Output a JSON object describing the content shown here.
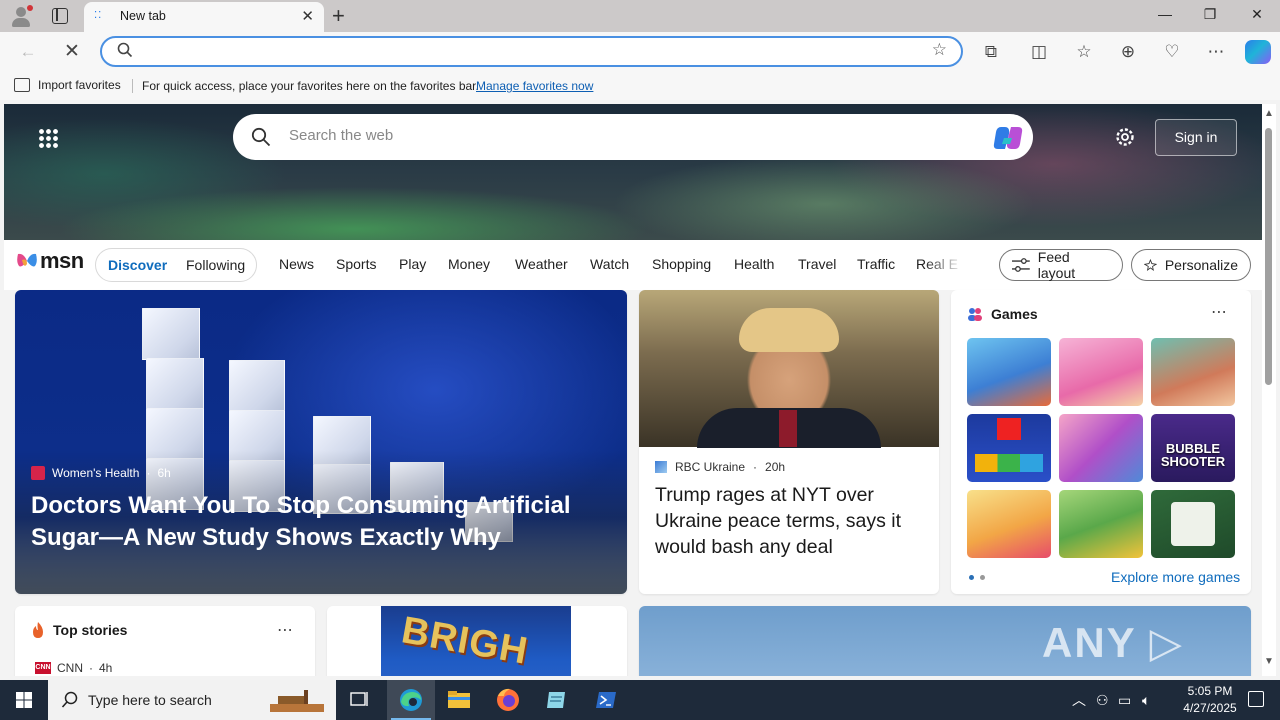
{
  "browser": {
    "tab_title": "New tab",
    "address_value": "",
    "favorites_bar": {
      "import_label": "Import favorites",
      "hint": "For quick access, place your favorites here on the favorites bar.",
      "manage_link": "Manage favorites now"
    }
  },
  "page": {
    "search_placeholder": "Search the web",
    "signin_label": "Sign in",
    "logo_text": "msn",
    "feed_tabs": [
      "Discover",
      "Following"
    ],
    "nav_links": [
      "News",
      "Sports",
      "Play",
      "Money",
      "Weather",
      "Watch",
      "Shopping",
      "Health",
      "Travel",
      "Traffic",
      "Real E"
    ],
    "feed_layout_label": "Feed layout",
    "personalize_label": "Personalize",
    "hero": {
      "source": "Women's Health",
      "age": "6h",
      "title": "Doctors Want You To Stop Consuming Artificial Sugar—A New Study Shows Exactly Why"
    },
    "story2": {
      "source": "RBC Ukraine",
      "age": "20h",
      "title": "Trump rages at NYT over Ukraine peace terms, says it would bash any deal"
    },
    "games": {
      "title": "Games",
      "tiles": [
        "",
        "",
        "",
        "",
        "",
        "BUBBLE SHOOTER",
        "",
        "",
        ""
      ],
      "explore_label": "Explore more games",
      "page_count": 2,
      "active_page": 1
    },
    "top_stories": {
      "title": "Top stories",
      "source": "CNN",
      "age": "4h"
    },
    "bright_sign": "BRIGH",
    "watermark": "ANY ▷ RUN"
  },
  "taskbar": {
    "search_placeholder": "Type here to search",
    "time": "5:05 PM",
    "date": "4/27/2025"
  },
  "colors": {
    "accent": "#0f6cbd",
    "address_border": "#4a90e2",
    "taskbar": "#1e2a3a"
  }
}
